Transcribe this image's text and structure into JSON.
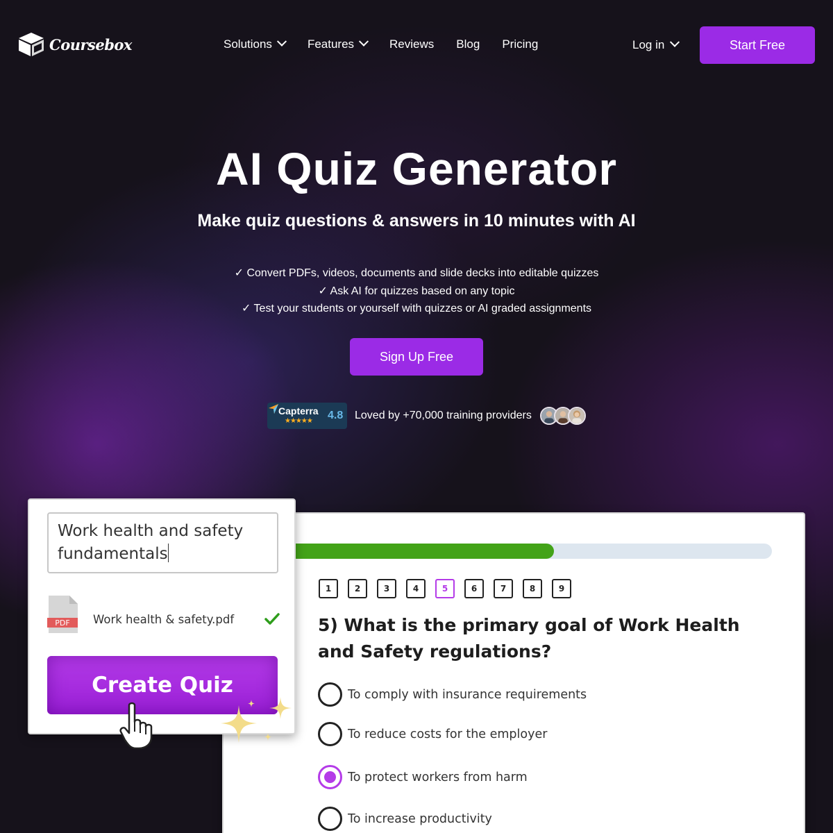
{
  "nav": {
    "brand": "Coursebox",
    "menu": [
      {
        "label": "Solutions"
      },
      {
        "label": "Features"
      },
      {
        "label": "Reviews"
      },
      {
        "label": "Blog"
      },
      {
        "label": "Pricing"
      }
    ],
    "login_label": "Log in",
    "start_label": "Start Free"
  },
  "hero": {
    "title": "AI Quiz Generator",
    "subtitle": "Make quiz questions & answers in 10 minutes with AI",
    "bullets": [
      "✓ Convert PDFs, videos, documents and slide decks into editable quizzes",
      "✓ Ask AI for quizzes based on any topic",
      "✓ Test your students or yourself with quizzes or AI graded assignments"
    ],
    "cta_label": "Sign Up Free"
  },
  "social_proof": {
    "capterra_name": "Capterra",
    "capterra_stars": "★★★★★",
    "capterra_score": "4.8",
    "loved_text": "Loved by +70,000 training providers"
  },
  "generator": {
    "topic_line1": "Work health and safety",
    "topic_line2": "fundamentals",
    "pdf_badge": "PDF",
    "file_name": "Work health & safety.pdf",
    "create_label": "Create Quiz"
  },
  "quiz": {
    "progress": 0.55,
    "numbers": [
      "1",
      "2",
      "3",
      "4",
      "5",
      "6",
      "7",
      "8",
      "9"
    ],
    "active_number": "5",
    "question": "5) What is the primary goal of Work Health and Safety regulations?",
    "options": [
      {
        "label": "To comply with insurance requirements",
        "selected": false
      },
      {
        "label": "To reduce costs for the employer",
        "selected": false
      },
      {
        "label": "To protect workers from harm",
        "selected": true
      },
      {
        "label": "To increase productivity",
        "selected": false
      }
    ]
  },
  "colors": {
    "accent": "#9b2be6",
    "progress_fill": "#43a318",
    "progress_track": "#dde6ef",
    "selected_option": "#b43be8"
  }
}
